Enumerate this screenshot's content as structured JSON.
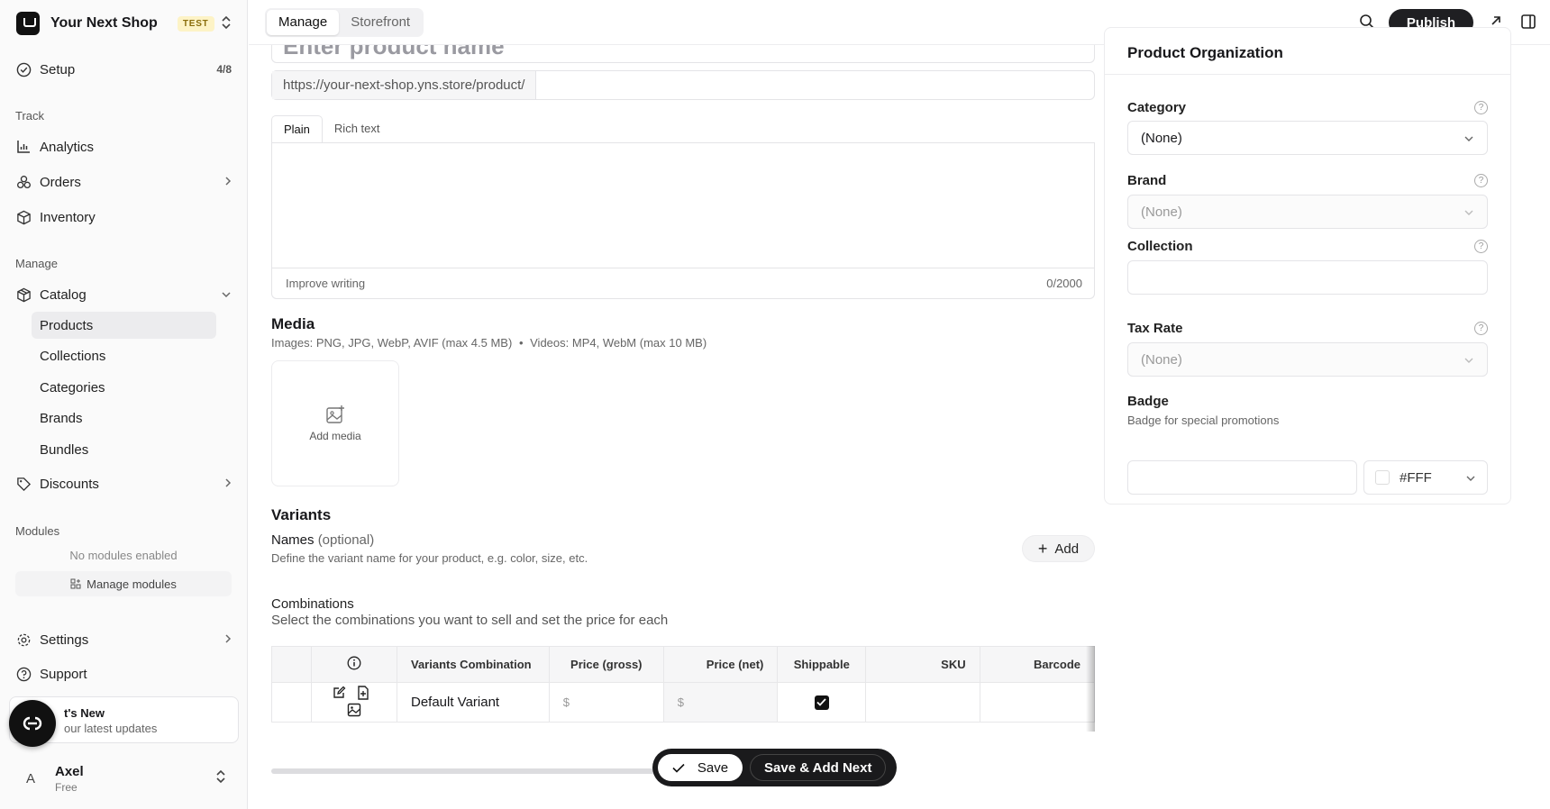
{
  "app": {
    "shop_name": "Your Next Shop",
    "env_badge": "TEST"
  },
  "sidebar": {
    "setup": {
      "label": "Setup",
      "progress": "4/8"
    },
    "sections": {
      "track": "Track",
      "manage": "Manage",
      "modules": "Modules"
    },
    "track_items": [
      {
        "label": "Analytics",
        "icon": "bar-chart-icon"
      },
      {
        "label": "Orders",
        "icon": "orders-icon"
      },
      {
        "label": "Inventory",
        "icon": "box-icon"
      }
    ],
    "catalog": {
      "label": "Catalog",
      "icon": "package-icon"
    },
    "catalog_items": [
      "Products",
      "Collections",
      "Categories",
      "Brands",
      "Bundles"
    ],
    "active_catalog_item": "Products",
    "discounts": {
      "label": "Discounts",
      "icon": "tag-icon"
    },
    "modules_empty": "No modules enabled",
    "manage_modules": "Manage modules",
    "settings": "Settings",
    "support": "Support",
    "whats_new": {
      "title": "t's New",
      "subtitle": "our latest updates"
    },
    "user": {
      "initial": "A",
      "name": "Axel",
      "plan": "Free"
    }
  },
  "topbar": {
    "tabs": [
      "Manage",
      "Storefront"
    ],
    "active_tab": "Manage",
    "publish": "Publish"
  },
  "product": {
    "name_placeholder": "Enter product name",
    "slug_prefix": "https://your-next-shop.yns.store/product/",
    "editor_tabs": [
      "Plain",
      "Rich text"
    ],
    "active_editor_tab": "Plain",
    "improve_writing": "Improve writing",
    "char_count": "0/2000"
  },
  "media": {
    "title": "Media",
    "images_hint": "Images: PNG, JPG, WebP, AVIF (max 4.5 MB)",
    "separator": "•",
    "videos_hint": "Videos: MP4, WebM (max 10 MB)",
    "add_media": "Add media"
  },
  "variants": {
    "title": "Variants",
    "names_label": "Names",
    "names_optional": "(optional)",
    "names_hint": "Define the variant name for your product, e.g. color, size, etc.",
    "add": "Add",
    "combinations_title": "Combinations",
    "combinations_hint": "Select the combinations you want to sell and set the price for each",
    "columns": [
      "Variants Combination",
      "Price (gross)",
      "Price (net)",
      "Shippable",
      "SKU",
      "Barcode"
    ],
    "rows": [
      {
        "name": "Default Variant",
        "price_gross": "$",
        "price_net": "$",
        "shippable": true,
        "sku": "",
        "barcode": ""
      }
    ]
  },
  "savebar": {
    "save": "Save",
    "save_add_next": "Save & Add Next"
  },
  "organization": {
    "title": "Product Organization",
    "category": {
      "label": "Category",
      "value": "(None)"
    },
    "brand": {
      "label": "Brand",
      "value": "(None)"
    },
    "collection": {
      "label": "Collection",
      "value": ""
    },
    "tax_rate": {
      "label": "Tax Rate",
      "value": "(None)"
    },
    "badge": {
      "label": "Badge",
      "hint": "Badge for special promotions",
      "color": "#FFF"
    }
  }
}
